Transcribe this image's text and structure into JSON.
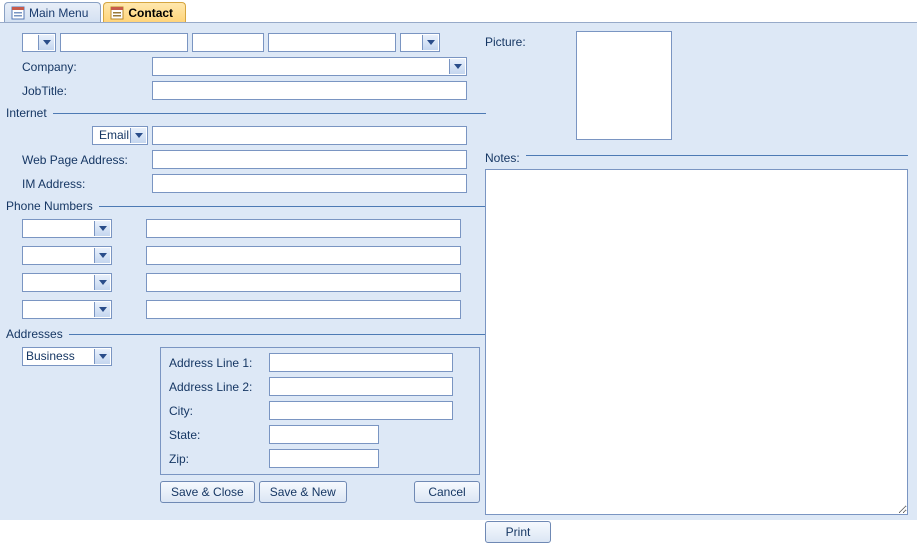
{
  "tabs": {
    "main_menu": "Main Menu",
    "contact": "Contact"
  },
  "top": {
    "prefix": "",
    "first": "",
    "middle": "",
    "last": "",
    "suffix": ""
  },
  "company_label": "Company:",
  "company_value": "",
  "jobtitle_label": "JobTitle:",
  "jobtitle_value": "",
  "picture_label": "Picture:",
  "sections": {
    "internet": "Internet",
    "phone": "Phone Numbers",
    "addresses": "Addresses"
  },
  "internet": {
    "email_type": "Email",
    "email_value": "",
    "web_label": "Web Page Address:",
    "web_value": "",
    "im_label": "IM Address:",
    "im_value": ""
  },
  "phone": {
    "type1": "",
    "val1": "",
    "type2": "",
    "val2": "",
    "type3": "",
    "val3": "",
    "type4": "",
    "val4": ""
  },
  "notes_label": "Notes:",
  "notes_value": "",
  "address": {
    "type": "Business",
    "line1_label": "Address Line 1:",
    "line1": "",
    "line2_label": "Address Line 2:",
    "line2": "",
    "city_label": "City:",
    "city": "",
    "state_label": "State:",
    "state": "",
    "zip_label": "Zip:",
    "zip": ""
  },
  "buttons": {
    "save_close": "Save & Close",
    "save_new": "Save & New",
    "cancel": "Cancel",
    "print": "Print"
  }
}
